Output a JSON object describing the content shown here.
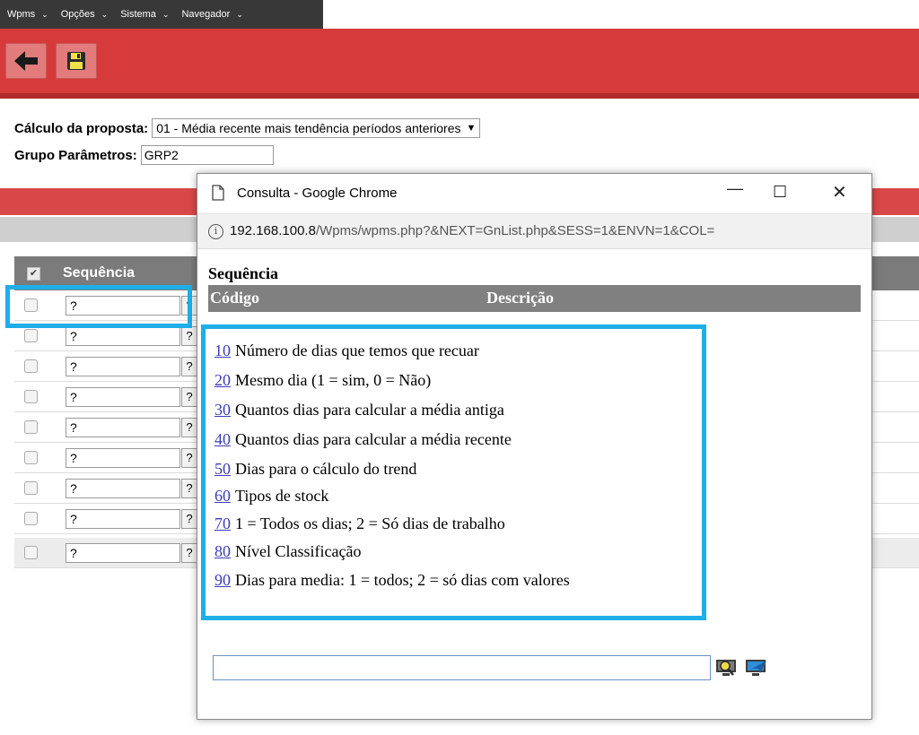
{
  "menubar": {
    "items": [
      {
        "label": "Wpms"
      },
      {
        "label": "Opções"
      },
      {
        "label": "Sistema"
      },
      {
        "label": "Navegador"
      }
    ],
    "chevron": "⌄"
  },
  "toolbar": {
    "back_icon": "arrow-left-icon",
    "save_icon": "floppy-disk-icon"
  },
  "form": {
    "calculo_label": "Cálculo da proposta:",
    "calculo_value": "01 - Média recente mais tendência períodos anteriores",
    "grupo_label": "Grupo Parâmetros:",
    "grupo_value": "GRP2"
  },
  "table": {
    "header_check": "✔",
    "header_sequencia": "Sequência",
    "rows": [
      {
        "value": "?",
        "btn": "?"
      },
      {
        "value": "?",
        "btn": "?"
      },
      {
        "value": "?",
        "btn": "?"
      },
      {
        "value": "?",
        "btn": "?"
      },
      {
        "value": "?",
        "btn": "?"
      },
      {
        "value": "?",
        "btn": "?"
      },
      {
        "value": "?",
        "btn": "?"
      },
      {
        "value": "?",
        "btn": "?"
      },
      {
        "value": "?",
        "btn": "?"
      }
    ]
  },
  "popup": {
    "title": "Consulta - Google Chrome",
    "minimize": "—",
    "maximize": "☐",
    "close": "✕",
    "info": "i",
    "url_host": "192.168.100.8",
    "url_path": "/Wpms/wpms.php?&NEXT=GnList.php&SESS=1&ENVN=1&COL=",
    "heading": "Sequência",
    "col_codigo": "Código",
    "col_descricao": "Descrição",
    "items": [
      {
        "code": "10",
        "desc": "Número de dias que temos que recuar"
      },
      {
        "code": "20",
        "desc": "Mesmo dia (1 = sim, 0 = Não)"
      },
      {
        "code": "30",
        "desc": "Quantos dias para calcular a média antiga"
      },
      {
        "code": "40",
        "desc": "Quantos dias para calcular a média recente"
      },
      {
        "code": "50",
        "desc": "Dias para o cálculo do trend"
      },
      {
        "code": "60",
        "desc": "Tipos de stock"
      },
      {
        "code": "70",
        "desc": "1 = Todos os dias; 2 = Só dias de trabalho"
      },
      {
        "code": "80",
        "desc": "Nível Classificação"
      },
      {
        "code": "90",
        "desc": "Dias para media: 1 = todos; 2 = só dias com valores"
      }
    ],
    "search_value": ""
  },
  "colors": {
    "toolbar_red": "#d63a3a",
    "highlight_blue": "#1eaee8",
    "link_blue": "#3b3bb8"
  }
}
